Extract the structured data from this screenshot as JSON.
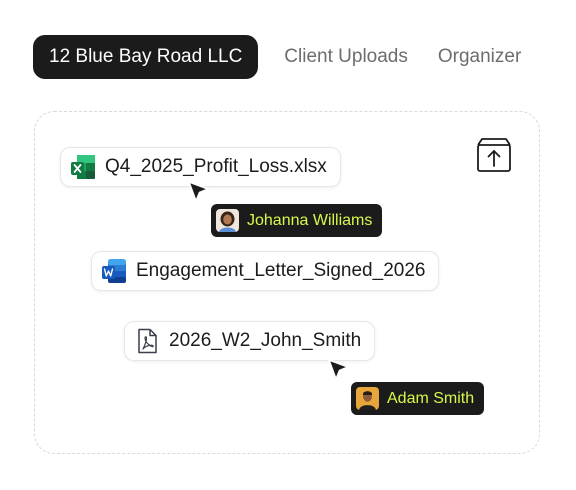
{
  "tabs": [
    {
      "label": "12 Blue Bay Road LLC",
      "active": true
    },
    {
      "label": "Client Uploads",
      "active": false
    },
    {
      "label": "Organizer",
      "active": false
    }
  ],
  "dropzone": {
    "upload_icon": "upload-box-icon"
  },
  "files": [
    {
      "name": "Q4_2025_Profit_Loss.xlsx",
      "icon": "excel-icon"
    },
    {
      "name": "Engagement_Letter_Signed_2026",
      "icon": "word-icon"
    },
    {
      "name": "2026_W2_John_Smith",
      "icon": "pdf-icon"
    }
  ],
  "users": [
    {
      "name": "Johanna Williams"
    },
    {
      "name": "Adam Smith"
    }
  ],
  "colors": {
    "active_tab_bg": "#1b1b1b",
    "user_tag_text": "#d6f94a",
    "excel_green": "#1e8e4e",
    "word_blue": "#1f5fd1"
  }
}
